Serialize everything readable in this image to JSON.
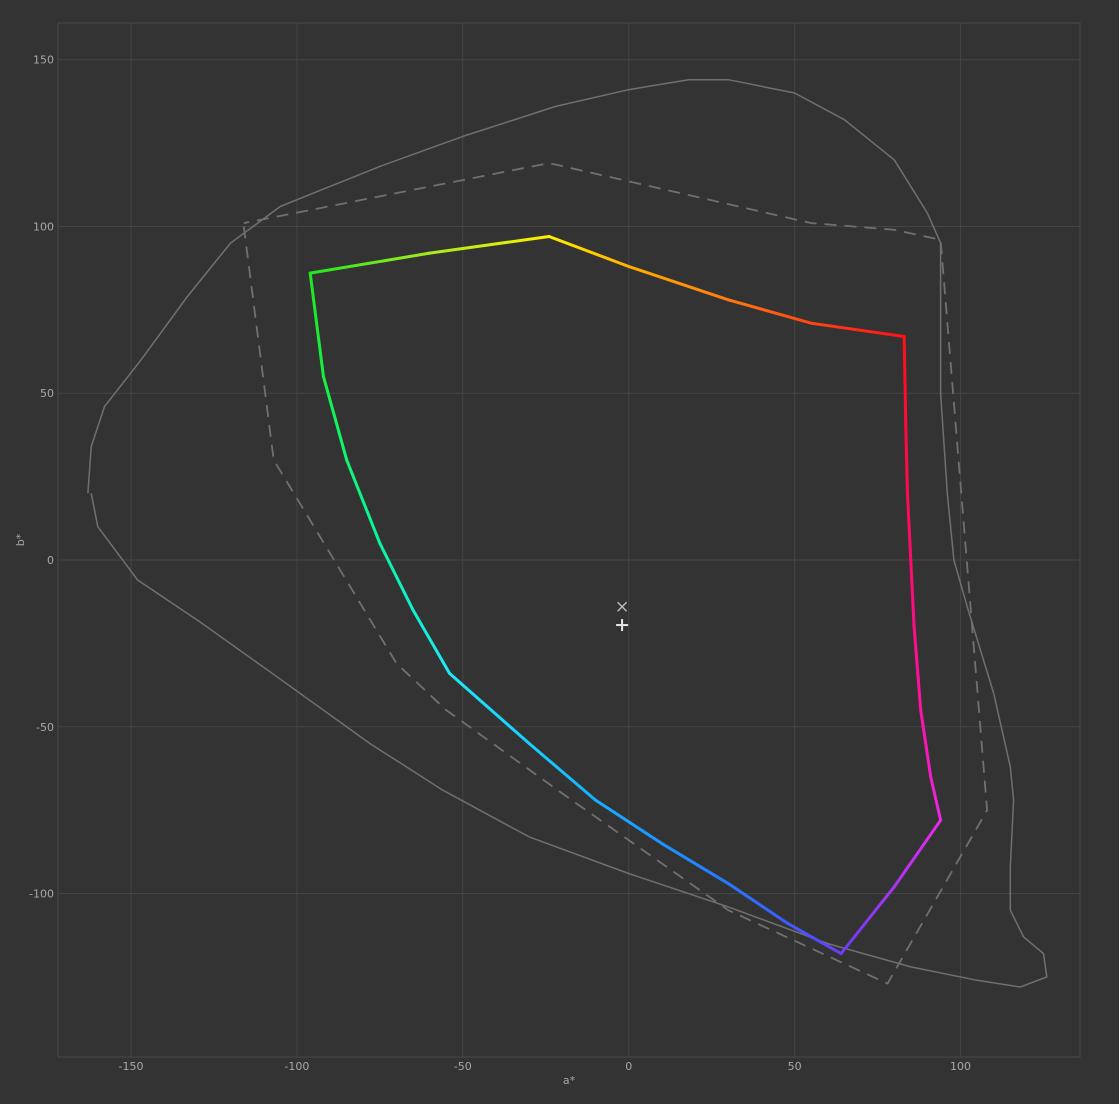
{
  "chart_data": {
    "type": "line",
    "title": "",
    "xlabel": "a*",
    "ylabel": "b*",
    "xlim": [
      -172,
      136
    ],
    "ylim": [
      -149,
      161
    ],
    "grid": true,
    "x_ticks": [
      -150,
      -100,
      -50,
      0,
      50,
      100
    ],
    "y_ticks": [
      -100,
      -50,
      0,
      50,
      100,
      150
    ],
    "colors": {
      "background": "#333333",
      "grid": "#454545",
      "frame": "#4a4a4a",
      "reference": "#707070",
      "markers": "#e8e8e8"
    },
    "series": [
      {
        "style": "solid-thin-gray",
        "points": [
          [
            -162,
            20
          ],
          [
            -160,
            10
          ],
          [
            -148,
            -6
          ],
          [
            -130,
            -18
          ],
          [
            -106,
            -35
          ],
          [
            -78,
            -55
          ],
          [
            -56,
            -69
          ],
          [
            -30,
            -83
          ],
          [
            0,
            -94
          ],
          [
            30,
            -104
          ],
          [
            60,
            -115
          ],
          [
            85,
            -122
          ],
          [
            105,
            -126
          ],
          [
            118,
            -128
          ],
          [
            126,
            -125
          ],
          [
            125,
            -118
          ],
          [
            119,
            -113
          ],
          [
            115,
            -105
          ],
          [
            115,
            -92
          ],
          [
            116,
            -72
          ],
          [
            115,
            -62
          ],
          [
            110,
            -40
          ],
          [
            102,
            -14
          ],
          [
            98,
            0
          ],
          [
            96,
            20
          ],
          [
            94,
            50
          ],
          [
            94,
            80
          ],
          [
            94,
            95
          ],
          [
            90,
            104
          ],
          [
            80,
            120
          ],
          [
            65,
            132
          ],
          [
            50,
            140
          ],
          [
            30,
            144
          ],
          [
            18,
            144
          ],
          [
            0,
            141
          ],
          [
            -22,
            136
          ],
          [
            -50,
            127
          ],
          [
            -75,
            118
          ],
          [
            -95,
            110
          ],
          [
            -105,
            106
          ],
          [
            -120,
            95
          ],
          [
            -133,
            79
          ],
          [
            -147,
            60
          ],
          [
            -158,
            46
          ],
          [
            -162,
            34
          ],
          [
            -163,
            20
          ]
        ]
      },
      {
        "style": "dashed-gray",
        "points": [
          [
            -116,
            100
          ],
          [
            -107,
            30
          ],
          [
            -70,
            -31
          ],
          [
            -55,
            -45
          ],
          [
            -20,
            -70
          ],
          [
            30,
            -105
          ],
          [
            78,
            -127
          ],
          [
            108,
            -75
          ],
          [
            94,
            96
          ],
          [
            80,
            99
          ],
          [
            55,
            101
          ],
          [
            -24,
            119
          ],
          [
            -116,
            101
          ]
        ]
      },
      {
        "style": "gradient-gamut",
        "points": [
          [
            -24,
            97
          ],
          [
            0,
            88
          ],
          [
            30,
            78
          ],
          [
            55,
            71
          ],
          [
            83,
            67
          ],
          [
            83.5,
            40
          ],
          [
            84,
            20
          ],
          [
            85,
            0
          ],
          [
            86,
            -20
          ],
          [
            88,
            -45
          ],
          [
            91,
            -65
          ],
          [
            94,
            -78
          ],
          [
            80,
            -98
          ],
          [
            64,
            -118
          ],
          [
            48,
            -109
          ],
          [
            30,
            -97
          ],
          [
            10,
            -85
          ],
          [
            -10,
            -72
          ],
          [
            -30,
            -55
          ],
          [
            -54,
            -34
          ],
          [
            -65,
            -15
          ],
          [
            -75,
            5
          ],
          [
            -85,
            30
          ],
          [
            -92,
            55
          ],
          [
            -96,
            86
          ],
          [
            -60,
            92
          ],
          [
            -24,
            97
          ]
        ]
      }
    ],
    "point_colors": [
      "#ffee00",
      "#ffb000",
      "#ff7a10",
      "#ff4414",
      "#ff1018",
      "#ff0a3a",
      "#ff0a52",
      "#ff0a6a",
      "#ff0c88",
      "#ff12a8",
      "#f51cc8",
      "#ea28ea",
      "#a834f0",
      "#6a3cf6",
      "#3e5cff",
      "#2878ff",
      "#1c94ff",
      "#14b0ff",
      "#18cfff",
      "#1ee8f6",
      "#10f0cc",
      "#0cf49e",
      "#10f670",
      "#18f040",
      "#22e61e",
      "#a6ea1e",
      "#ffee00"
    ],
    "markers": [
      {
        "symbol": "×",
        "a": -2,
        "b": -14
      },
      {
        "symbol": "+",
        "a": -2,
        "b": -19.5
      }
    ]
  }
}
